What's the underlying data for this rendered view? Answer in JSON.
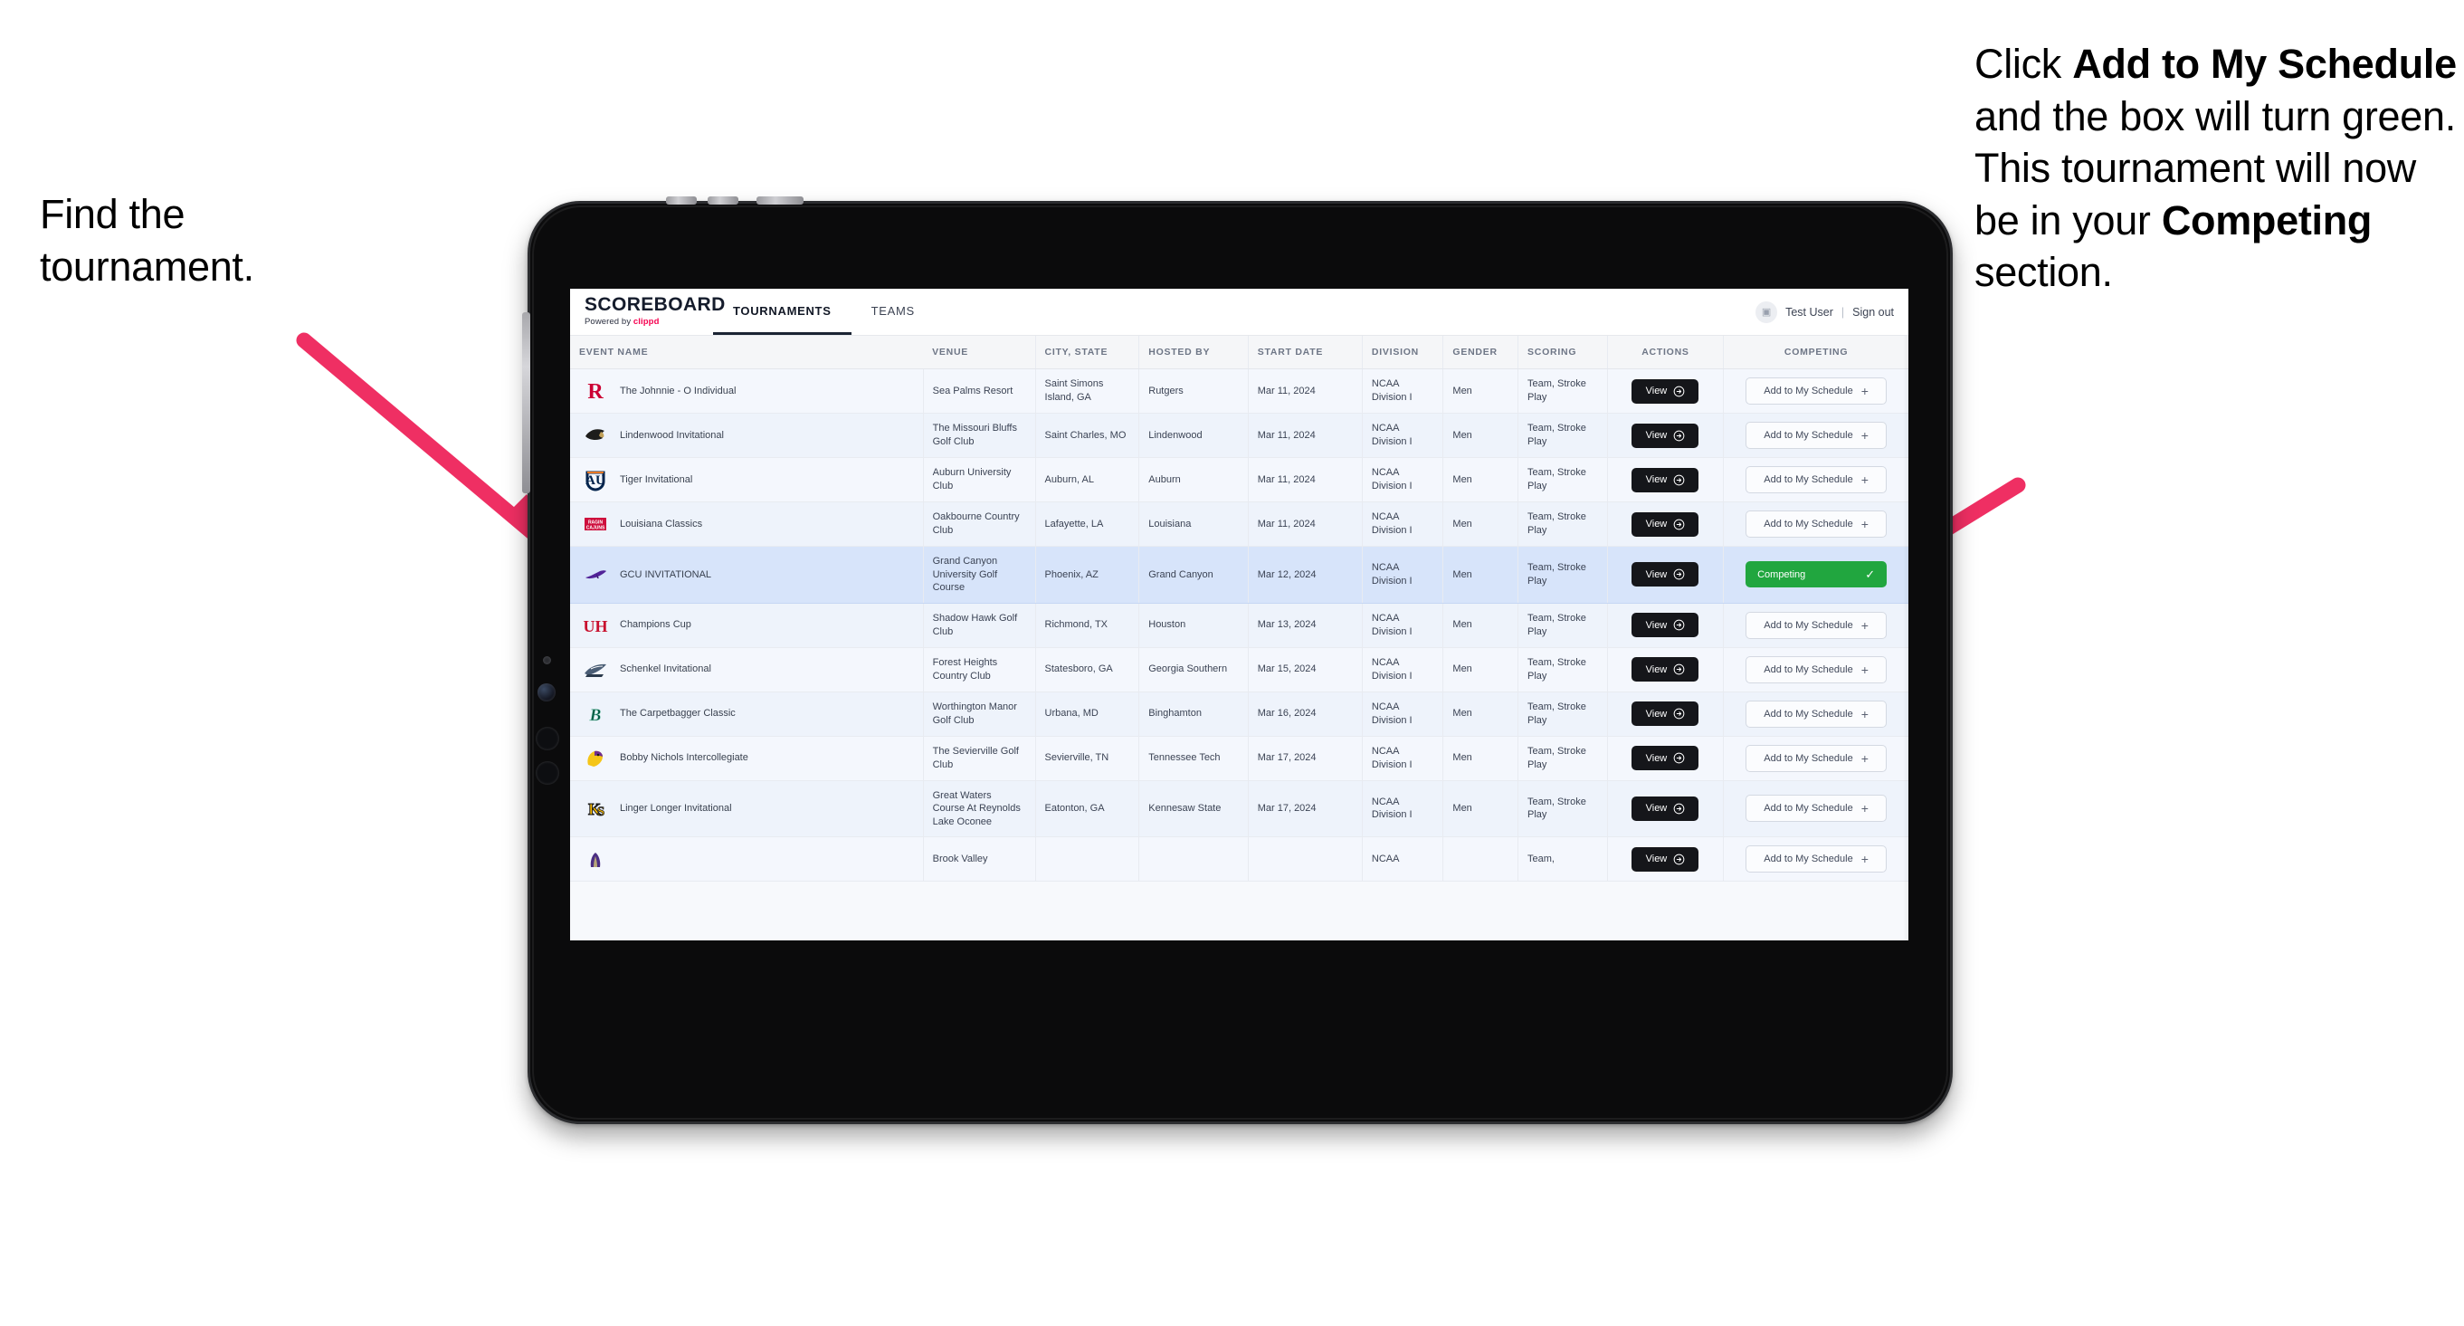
{
  "annotations": {
    "left": {
      "lines": [
        "Find the",
        "tournament."
      ]
    },
    "right": {
      "pre1": "Click ",
      "bold1": "Add to My Schedule",
      "mid": " and the box will turn green. This tournament will now be in your ",
      "bold2": "Competing",
      "post": " section."
    }
  },
  "app": {
    "brand": {
      "title": "SCOREBOARD",
      "powered_prefix": "Powered by ",
      "powered_name": "clippd"
    },
    "tabs": [
      {
        "label": "TOURNAMENTS",
        "active": true
      },
      {
        "label": "TEAMS",
        "active": false
      }
    ],
    "user": {
      "name": "Test User",
      "separator": "|",
      "signout": "Sign out",
      "avatar_glyph": "▣"
    }
  },
  "table": {
    "columns": [
      "EVENT NAME",
      "VENUE",
      "CITY, STATE",
      "HOSTED BY",
      "START DATE",
      "DIVISION",
      "GENDER",
      "SCORING",
      "ACTIONS",
      "COMPETING"
    ],
    "buttons": {
      "view": "View",
      "add": "Add to My Schedule",
      "add_plus": "+",
      "competing": "Competing",
      "competing_check": "✓"
    },
    "rows": [
      {
        "event": "The Johnnie - O Individual",
        "venue": "Sea Palms Resort",
        "city": "Saint Simons Island, GA",
        "host": "Rutgers",
        "date": "Mar 11, 2024",
        "division": "NCAA Division I",
        "gender": "Men",
        "scoring": "Team, Stroke Play",
        "competing": false,
        "logo": "rutgers-logo"
      },
      {
        "event": "Lindenwood Invitational",
        "venue": "The Missouri Bluffs Golf Club",
        "city": "Saint Charles, MO",
        "host": "Lindenwood",
        "date": "Mar 11, 2024",
        "division": "NCAA Division I",
        "gender": "Men",
        "scoring": "Team, Stroke Play",
        "competing": false,
        "logo": "lindenwood-logo"
      },
      {
        "event": "Tiger Invitational",
        "venue": "Auburn University Club",
        "city": "Auburn, AL",
        "host": "Auburn",
        "date": "Mar 11, 2024",
        "division": "NCAA Division I",
        "gender": "Men",
        "scoring": "Team, Stroke Play",
        "competing": false,
        "logo": "auburn-logo"
      },
      {
        "event": "Louisiana Classics",
        "venue": "Oakbourne Country Club",
        "city": "Lafayette, LA",
        "host": "Louisiana",
        "date": "Mar 11, 2024",
        "division": "NCAA Division I",
        "gender": "Men",
        "scoring": "Team, Stroke Play",
        "competing": false,
        "logo": "louisiana-logo"
      },
      {
        "event": "GCU INVITATIONAL",
        "venue": "Grand Canyon University Golf Course",
        "city": "Phoenix, AZ",
        "host": "Grand Canyon",
        "date": "Mar 12, 2024",
        "division": "NCAA Division I",
        "gender": "Men",
        "scoring": "Team, Stroke Play",
        "competing": true,
        "logo": "gcu-logo"
      },
      {
        "event": "Champions Cup",
        "venue": "Shadow Hawk Golf Club",
        "city": "Richmond, TX",
        "host": "Houston",
        "date": "Mar 13, 2024",
        "division": "NCAA Division I",
        "gender": "Men",
        "scoring": "Team, Stroke Play",
        "competing": false,
        "logo": "houston-logo"
      },
      {
        "event": "Schenkel Invitational",
        "venue": "Forest Heights Country Club",
        "city": "Statesboro, GA",
        "host": "Georgia Southern",
        "date": "Mar 15, 2024",
        "division": "NCAA Division I",
        "gender": "Men",
        "scoring": "Team, Stroke Play",
        "competing": false,
        "logo": "georgia-southern-logo"
      },
      {
        "event": "The Carpetbagger Classic",
        "venue": "Worthington Manor Golf Club",
        "city": "Urbana, MD",
        "host": "Binghamton",
        "date": "Mar 16, 2024",
        "division": "NCAA Division I",
        "gender": "Men",
        "scoring": "Team, Stroke Play",
        "competing": false,
        "logo": "binghamton-logo"
      },
      {
        "event": "Bobby Nichols Intercollegiate",
        "venue": "The Sevierville Golf Club",
        "city": "Sevierville, TN",
        "host": "Tennessee Tech",
        "date": "Mar 17, 2024",
        "division": "NCAA Division I",
        "gender": "Men",
        "scoring": "Team, Stroke Play",
        "competing": false,
        "logo": "tennessee-tech-logo"
      },
      {
        "event": "Linger Longer Invitational",
        "venue": "Great Waters Course At Reynolds Lake Oconee",
        "city": "Eatonton, GA",
        "host": "Kennesaw State",
        "date": "Mar 17, 2024",
        "division": "NCAA Division I",
        "gender": "Men",
        "scoring": "Team, Stroke Play",
        "competing": false,
        "logo": "kennesaw-logo"
      },
      {
        "event": "",
        "venue": "Brook Valley",
        "city": "",
        "host": "",
        "date": "",
        "division": "NCAA",
        "gender": "",
        "scoring": "Team,",
        "competing": false,
        "logo": "partial-logo"
      }
    ]
  },
  "colors": {
    "competing_green": "#21a63f",
    "selected_row": "#d7e4fa",
    "arrow_pink": "#ef2f63",
    "brand_accent": "#f5004f",
    "view_button": "#15161a"
  }
}
